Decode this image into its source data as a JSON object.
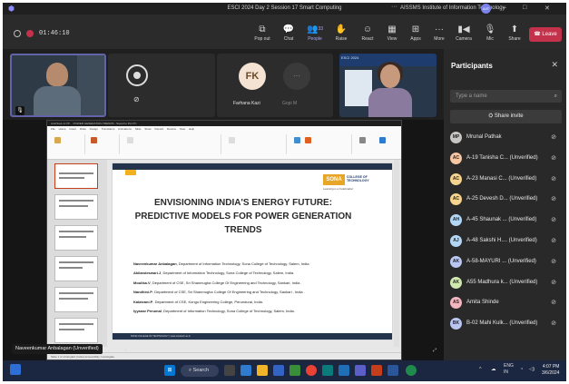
{
  "window": {
    "title": "ESCI 2024 Day 2 Session 17 Smart Computing",
    "org": "AISSMS Institute of Information Technology",
    "org_avatar": "AIIT",
    "more": "···",
    "minimize": "–",
    "maximize": "□",
    "close": "✕",
    "app_icon": "teams-icon"
  },
  "meeting": {
    "timer": "01:46:10",
    "buttons": [
      {
        "label": "Pop out",
        "icon": "⧉"
      },
      {
        "label": "Chat",
        "icon": "💬"
      },
      {
        "label": "People",
        "icon": "👥",
        "count": "33"
      },
      {
        "label": "Raise",
        "icon": "✋"
      },
      {
        "label": "React",
        "icon": "☺"
      },
      {
        "label": "View",
        "icon": "▦"
      },
      {
        "label": "Apps",
        "icon": "⊞"
      },
      {
        "label": "More",
        "icon": "···"
      },
      {
        "label": "Camera",
        "icon": "▮◀"
      },
      {
        "label": "Mic",
        "icon": "🎙"
      },
      {
        "label": "Share",
        "icon": "⬆"
      }
    ],
    "leave_label": "Leave",
    "leave_icon": "☎",
    "accent_color": "#6264a7",
    "leave_color": "#c4314b"
  },
  "video_tiles": [
    {
      "type": "camera",
      "muted_icon": "mic-off-icon"
    },
    {
      "type": "logo",
      "muted_icon": "mic-off-icon"
    },
    {
      "type": "avatar",
      "initials": "FK",
      "name": "Farhana Kazi",
      "second_name": "Gopi M"
    },
    {
      "type": "camera-speaker",
      "slide_text": "ESCI 2024"
    }
  ],
  "participants": {
    "title": "Participants",
    "close_icon": "✕",
    "search_placeholder": "Type a name",
    "share_invite": "Share invite",
    "list": [
      {
        "initials": "MP",
        "name": "Mrunal Pathak",
        "color": "#c8c6c4"
      },
      {
        "initials": "AC",
        "name": "A-19 Tanisha C... (Unverified)",
        "color": "#f7c6a3"
      },
      {
        "initials": "AC",
        "name": "A-23 Manasi C... (Unverified)",
        "color": "#f4d48e"
      },
      {
        "initials": "AC",
        "name": "A-25 Devesh D... (Unverified)",
        "color": "#f4d48e"
      },
      {
        "initials": "AH",
        "name": "A-45 Shaunak ... (Unverified)",
        "color": "#b4d6f5"
      },
      {
        "initials": "AJ",
        "name": "A-48 Sakshi H.... (Unverified)",
        "color": "#b4d6f5"
      },
      {
        "initials": "AK",
        "name": "A-58-MAYURI ... (Unverified)",
        "color": "#b8c6f0"
      },
      {
        "initials": "AK",
        "name": "A55 Madhura k... (Unverified)",
        "color": "#cfe8b0"
      },
      {
        "initials": "AS",
        "name": "Amita Shinde",
        "color": "#f3b6c0"
      },
      {
        "initials": "BK",
        "name": "B-02 Mahi Kulk... (Unverified)",
        "color": "#b8c6f0"
      }
    ]
  },
  "share": {
    "sharer": "Naveenkumar Anbalagan (Unverified)",
    "ppt_title": "AutoSave ● Off  ...  POWER GENERATION TRENDS - Saved to this PC",
    "ppt_tabs": "File Home Insert Draw Design Transitions Animations Slide Show Record Review View Help",
    "ppt_status": "Slide 1 of 14   English (India)   Accessibility: Investigate",
    "slide": {
      "logo": "SONA",
      "logo_sub": "COLLEGE OF TECHNOLOGY",
      "logo_tag": "Learning is a Celebration",
      "title_lines": [
        "ENVISIONING INDIA'S ENERGY FUTURE:",
        "PREDICTIVE MODELS FOR POWER GENERATION",
        "TRENDS"
      ],
      "authors": [
        {
          "name": "Naveenkumar Anbalagan",
          "affil": ", Department of Information Technology, Sona College of Technology, Salem, India"
        },
        {
          "name": "Akilandeswari.J",
          "affil": ", Department of Information Technology, Sona College of Technology, Salem, India."
        },
        {
          "name": "Moulika.V",
          "affil": ", Department of CSE, Sri Shanmugha College Of Engineering and Technology, Sankari, India ."
        },
        {
          "name": "Nandhini.P",
          "affil": ", Department of CSE, Sri Shanmugha College Of Engineering and Technology, Sankari , India ."
        },
        {
          "name": "Kalaivani.P",
          "affil": ", Department of CSE, Kongu Engineering College,  Perundurai, India."
        },
        {
          "name": "Iyyanar Perumal",
          "affil": " ,Department of Information Technology, Sona College of Technology, Salem, India."
        }
      ],
      "footer": "SONA COLLEGE OF TECHNOLOGY  |  www.sonatech.ac.in"
    }
  },
  "taskbar": {
    "search_label": "Search",
    "tray_lang": "ENG",
    "tray_region": "IN",
    "time": "4:07 PM",
    "date": "3/6/2024"
  }
}
